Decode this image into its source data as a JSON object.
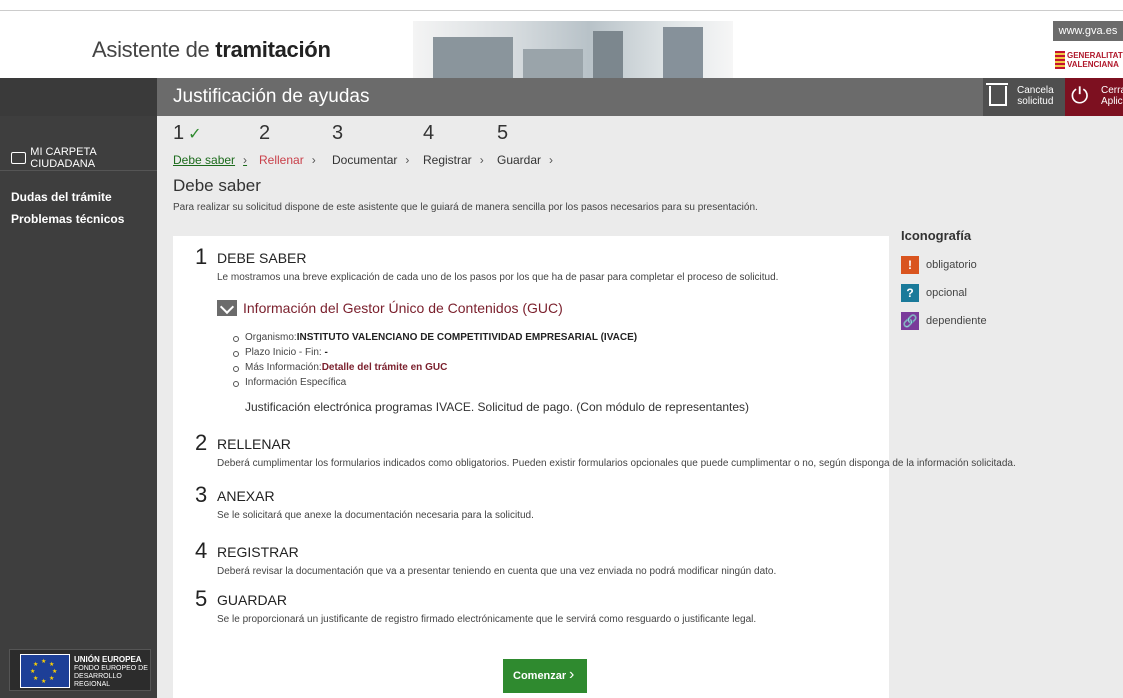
{
  "header": {
    "title_prefix": "Asistente de",
    "title_bold": "tramitación",
    "gva_link": "www.gva.es",
    "logo_line1": "GENERALITAT",
    "logo_line2": "VALENCIANA"
  },
  "sidebar": {
    "carpeta": "MI CARPETA CIUDADANA",
    "links": [
      "Dudas del trámite",
      "Problemas técnicos"
    ],
    "eu": {
      "line1": "UNIÓN EUROPEA",
      "line2": "FONDO EUROPEO DE",
      "line3": "DESARROLLO REGIONAL"
    }
  },
  "titlebar": {
    "title": "Justificación de ayudas",
    "cancel_l1": "Cancela",
    "cancel_l2": "solicitud",
    "close_l1": "Cerrar",
    "close_l2": "Aplicación"
  },
  "steps": [
    {
      "num": "1",
      "label": "Debe saber",
      "done": true,
      "state": "active"
    },
    {
      "num": "2",
      "label": "Rellenar",
      "state": "error"
    },
    {
      "num": "3",
      "label": "Documentar",
      "state": "normal"
    },
    {
      "num": "4",
      "label": "Registrar",
      "state": "normal"
    },
    {
      "num": "5",
      "label": "Guardar",
      "state": "normal"
    }
  ],
  "page": {
    "title": "Debe saber",
    "subtitle": "Para realizar su solicitud dispone de este asistente que le guiará de manera sencilla por los pasos necesarios para su presentación."
  },
  "sections": [
    {
      "num": "1",
      "heading": "DEBE SABER",
      "desc": "Le mostramos una breve explicación de cada uno de los pasos por los que ha de pasar para completar el proceso de solicitud."
    },
    {
      "num": "2",
      "heading": "RELLENAR",
      "desc": "Deberá cumplimentar los formularios indicados como obligatorios. Pueden existir formularios opcionales que puede cumplimentar o no, según disponga de la información solicitada."
    },
    {
      "num": "3",
      "heading": "ANEXAR",
      "desc": "Se le solicitará que anexe la documentación necesaria para la solicitud."
    },
    {
      "num": "4",
      "heading": "REGISTRAR",
      "desc": "Deberá revisar la documentación que va a presentar teniendo en cuenta que una vez enviada no podrá modificar ningún dato."
    },
    {
      "num": "5",
      "heading": "GUARDAR",
      "desc": "Se le proporcionará un justificante de registro firmado electrónicamente que le servirá como resguardo o justificante legal."
    }
  ],
  "guc": {
    "title": "Información del Gestor Único de Contenidos (GUC)",
    "organismo_label": "Organismo:",
    "organismo_value": "INSTITUTO VALENCIANO DE COMPETITIVIDAD EMPRESARIAL (IVACE)",
    "plazo_label": "Plazo Inicio - Fin:",
    "plazo_value": "-",
    "mas_label": "Más Información:",
    "mas_value": "Detalle del trámite en GUC",
    "especifica_label": "Información Específica",
    "especifica_value": "Justificación electrónica programas IVACE. Solicitud de pago. (Con módulo de representantes)"
  },
  "start_button": "Comenzar",
  "iconografia": {
    "title": "Iconografía",
    "items": [
      {
        "symbol": "!",
        "label": "obligatorio",
        "color": "#d9541e"
      },
      {
        "symbol": "?",
        "label": "opcional",
        "color": "#1a7a9a"
      },
      {
        "symbol": "🔗",
        "label": "dependiente",
        "color": "#7a3a9a"
      }
    ]
  }
}
